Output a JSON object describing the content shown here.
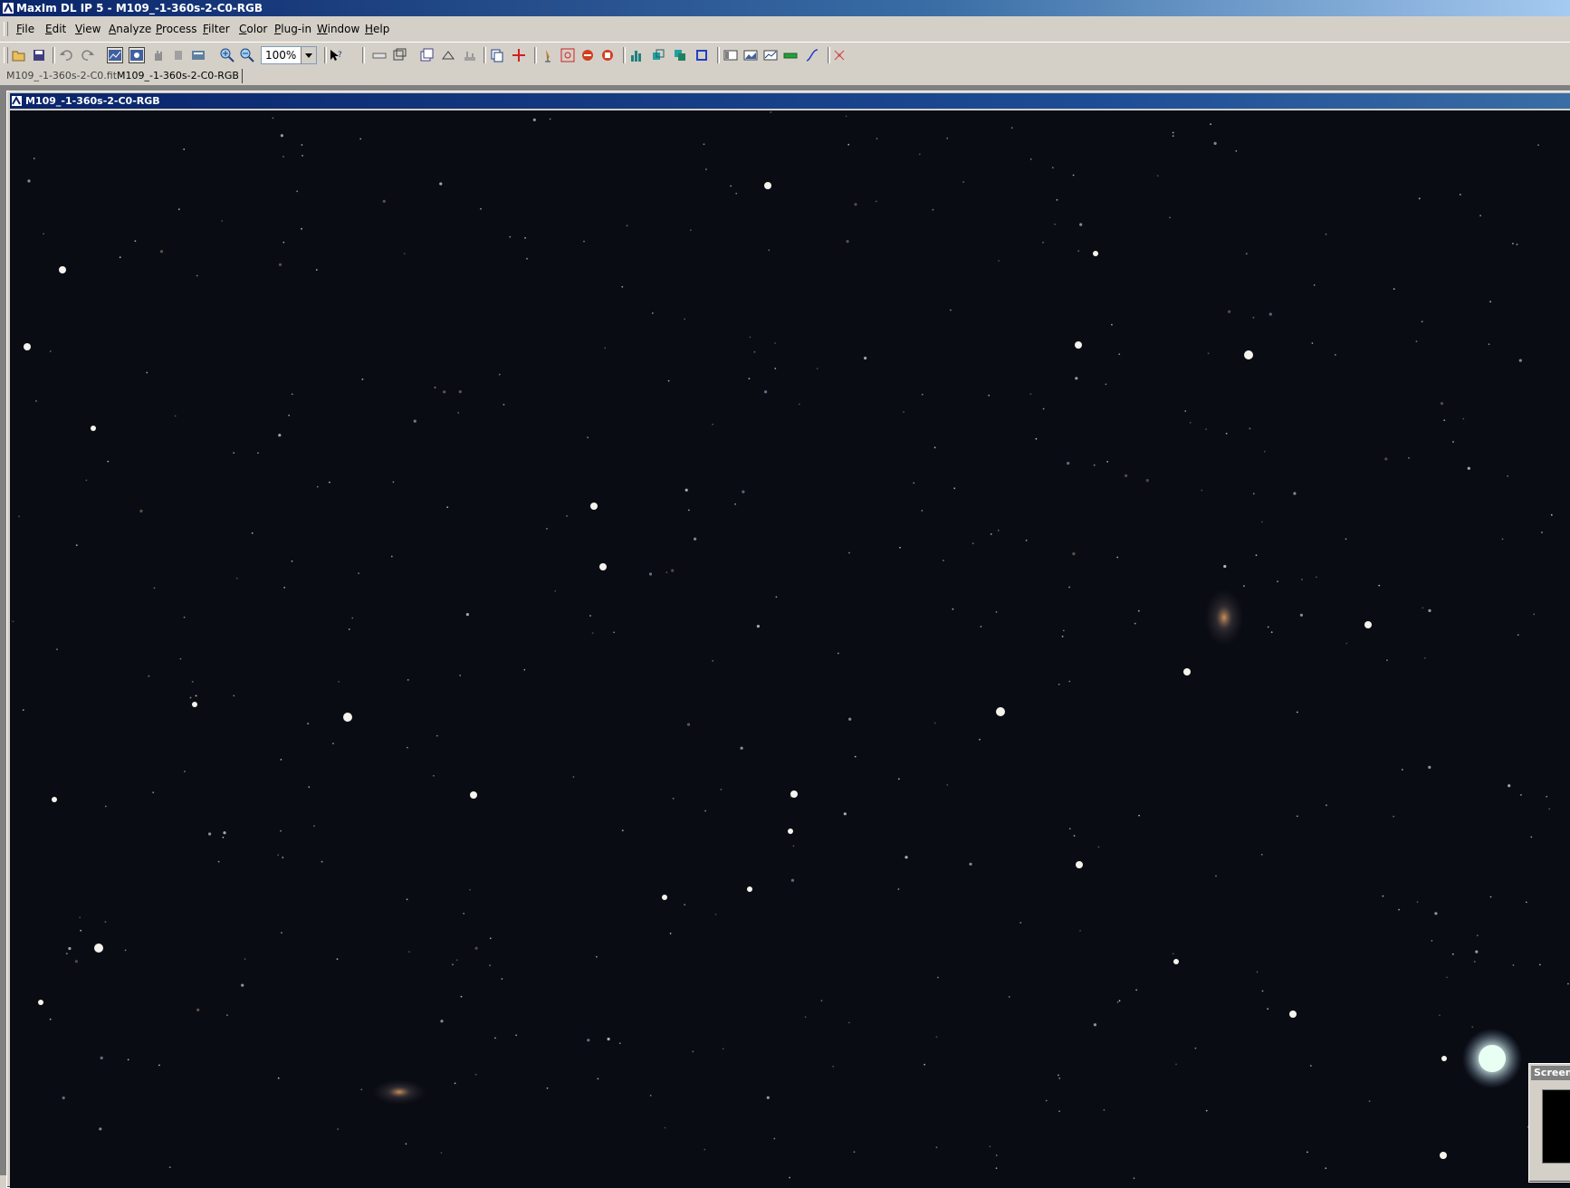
{
  "window": {
    "title": "MaxIm DL IP 5 - M109_-1-360s-2-C0-RGB"
  },
  "menu": {
    "items": [
      "File",
      "Edit",
      "View",
      "Analyze",
      "Process",
      "Filter",
      "Color",
      "Plug-in",
      "Window",
      "Help"
    ]
  },
  "toolbar": {
    "zoom_value": "100%",
    "icons": [
      "open-icon",
      "save-icon",
      "undo-icon",
      "redo-icon",
      "screen-stretch-icon",
      "auto-stretch-icon",
      "hand-icon",
      "pan-icon",
      "info-icon",
      "zoom-in-icon",
      "zoom-out-icon",
      "help-pointer-icon",
      "ruler-icon",
      "crop-icon",
      "stack-icon",
      "align-icon",
      "calibrate-icon",
      "copy-icon",
      "crosshair-icon",
      "telescope-icon",
      "target-icon",
      "no-entry-icon",
      "stop-icon",
      "histogram-icon",
      "layers-icon",
      "blend-icon",
      "frame-icon",
      "panel-icon",
      "image-icon",
      "graph-icon",
      "level-icon",
      "curve-icon",
      "star-remove-icon"
    ]
  },
  "tabs": [
    {
      "label": "M109_-1-360s-2-C0.fit",
      "active": false
    },
    {
      "label": "M109_-1-360s-2-C0-RGB",
      "active": true
    }
  ],
  "image_window": {
    "title": "M109_-1-360s-2-C0-RGB"
  },
  "screen_panel": {
    "title": "Screen"
  },
  "colors": {
    "title_bar": "#0a246a",
    "sky_background": "#0a0c14",
    "chrome": "#d4d0c8"
  }
}
